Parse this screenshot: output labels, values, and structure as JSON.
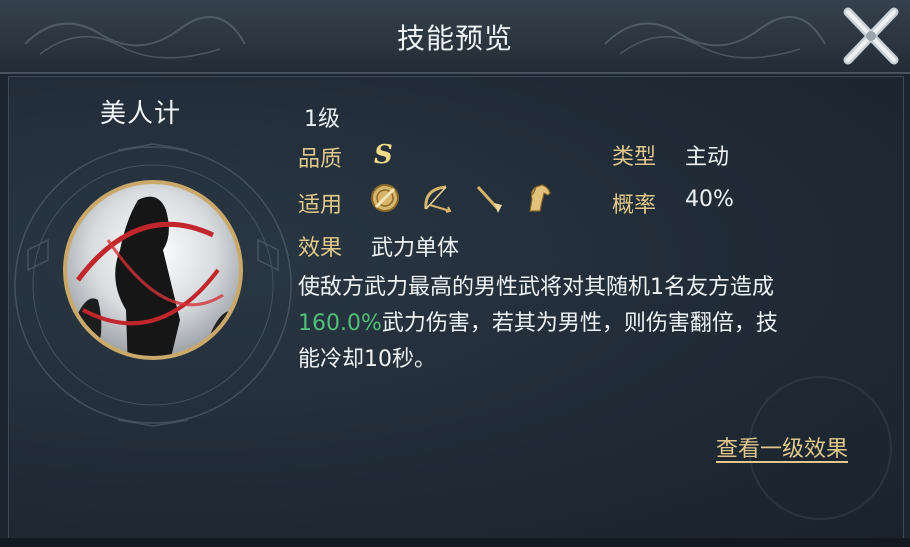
{
  "header": {
    "title": "技能预览"
  },
  "skill": {
    "name": "美人计",
    "level": "1级",
    "quality_label": "品质",
    "quality_value": "S",
    "type_label": "类型",
    "type_value": "主动",
    "applies_label": "适用",
    "applies_icons": [
      "shield-icon",
      "bow-icon",
      "spear-icon",
      "horse-icon"
    ],
    "rate_label": "概率",
    "rate_value": "40%",
    "effect_label": "效果",
    "effect_value": "武力单体",
    "desc_line1": "使敌方武力最高的男性武将对其随机1名友方造成",
    "desc_highlight": "160.0%",
    "desc_line2_rest": "武力伤害，若其为男性，则伤害翻倍，技",
    "desc_line3": "能冷却10秒。"
  },
  "footer": {
    "link_label": "查看一级效果"
  },
  "colors": {
    "label_gold": "#e0c88a",
    "highlight_green": "#4fbf7a",
    "grade_gold": "#f2dc8a"
  }
}
